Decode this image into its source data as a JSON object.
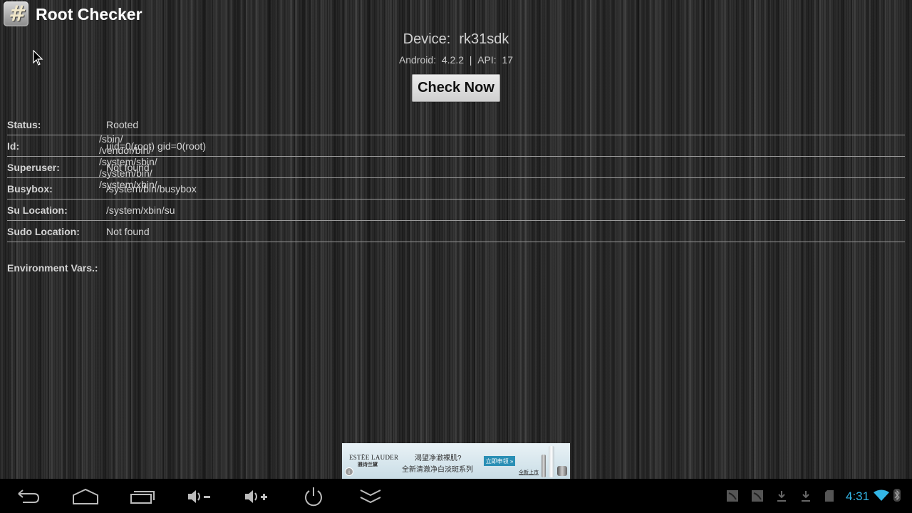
{
  "app": {
    "title": "Root Checker",
    "icon": "hash-app-icon",
    "icon_glyph": "#"
  },
  "device": {
    "label": "Device:",
    "name": "rk31sdk",
    "android_label": "Android:",
    "android_version": "4.2.2",
    "separator": "|",
    "api_label": "API:",
    "api_level": "17"
  },
  "check_button": {
    "label": "Check Now"
  },
  "info": {
    "rows": [
      {
        "label": "Status:",
        "value": "Rooted"
      },
      {
        "label": "Id:",
        "value": "uid=0(root) gid=0(root)"
      },
      {
        "label": "Superuser:",
        "value": "Not found"
      },
      {
        "label": "Busybox:",
        "value": "/system/bin/busybox"
      },
      {
        "label": "Su Location:",
        "value": "/system/xbin/su"
      },
      {
        "label": "Sudo Location:",
        "value": "Not found"
      }
    ],
    "env": {
      "label": "Environment Vars.:",
      "values": [
        "/sbin/",
        "/vendor/bin/",
        "/system/sbin/",
        "/system/bin/",
        "/system/xbin/"
      ]
    }
  },
  "ad": {
    "brand": "ESTĒE LAUDER",
    "brand_cn": "雅诗兰黛",
    "line1": "渴望净澈裸肌?",
    "line2": "全新清澈净白淡斑系列",
    "cta": "立即申领 »",
    "new_label": "全新上市",
    "info_glyph": "i"
  },
  "navbar": {
    "buttons": [
      "back",
      "home",
      "recent-apps",
      "volume-down",
      "volume-up",
      "power",
      "hide-bar"
    ]
  },
  "status": {
    "time": "4:31",
    "icons": [
      "notification-leaf-icon",
      "notification-leaf-icon",
      "download-icon",
      "download-icon",
      "sd-card-icon",
      "wifi-icon",
      "bluetooth-icon"
    ],
    "accent_color": "#33b5e5"
  }
}
